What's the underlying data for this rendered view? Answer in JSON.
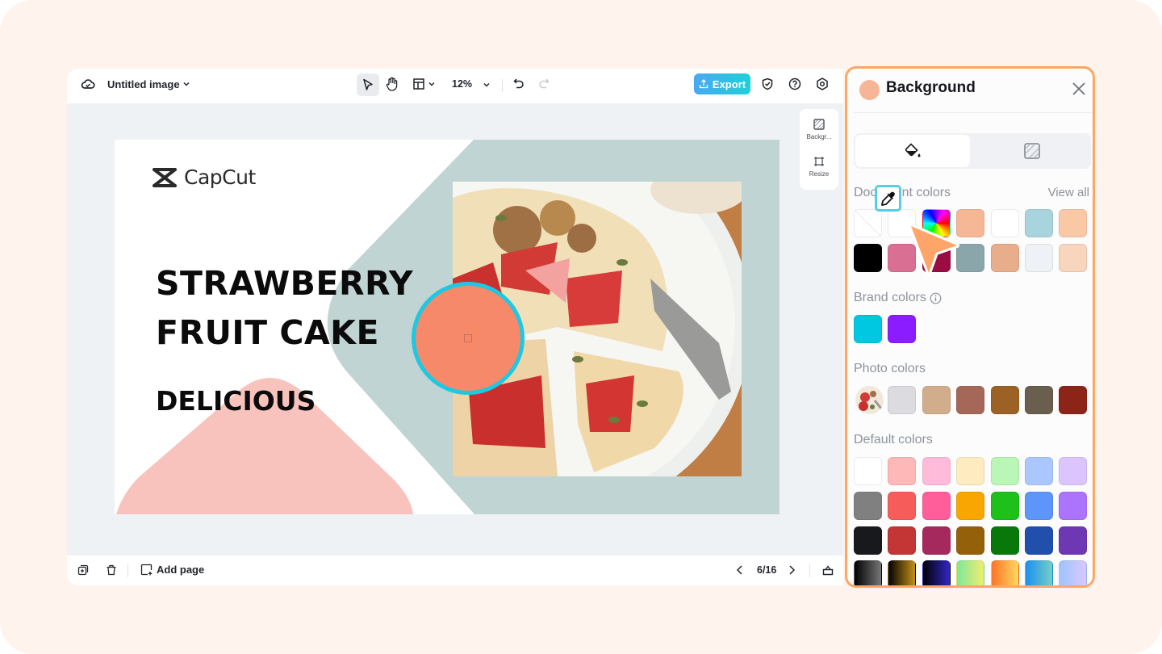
{
  "editor": {
    "doc_title": "Untitled image",
    "zoom_level": "12%",
    "export_label": "Export",
    "side_tools": [
      {
        "label": "Backgr...",
        "icon": "background-icon"
      },
      {
        "label": "Resize",
        "icon": "resize-icon"
      }
    ],
    "add_page_label": "Add page",
    "page_indicator": "6/16"
  },
  "canvas": {
    "logo_text": "CapCut",
    "headline_line1": "STRAWBERRY",
    "headline_line2": "FRUIT CAKE",
    "subheading": "DELICIOUS",
    "colors": {
      "background": "#ffffff",
      "sage_shape": "#c0d5d3",
      "pink_shape": "#f8c3bd",
      "circle_fill": "#f5896a",
      "circle_border": "#1ec8e2"
    }
  },
  "panel": {
    "title": "Background",
    "current_color": "#f6b597",
    "tabs": [
      {
        "name": "fill",
        "icon": "paint-bucket-icon",
        "active": true
      },
      {
        "name": "pattern",
        "icon": "pattern-icon",
        "active": false
      }
    ],
    "document_colors": {
      "label": "Document colors",
      "view_all_label": "View all",
      "swatches": [
        [
          "none",
          "eyedropper",
          "rainbow",
          "#f6b797",
          "#ffffff",
          "#a8d5dd",
          "#f9c9a6"
        ],
        [
          "#000000",
          "#d96f92",
          "#9b0c44",
          "#8aa6ab",
          "#e8ae8c",
          "#eef2f6",
          "#f8d5bd"
        ]
      ]
    },
    "brand_colors": {
      "label": "Brand colors",
      "swatches": [
        "#00c8e0",
        "#8a1cff"
      ]
    },
    "photo_colors": {
      "label": "Photo colors",
      "swatches": [
        "#dcdbe0",
        "#d2ad8b",
        "#a56858",
        "#9c6124",
        "#6a5e4e",
        "#8c2418"
      ]
    },
    "default_colors": {
      "label": "Default colors",
      "rows": [
        [
          "#ffffff",
          "#ffb8b8",
          "#ffbbd9",
          "#ffebc0",
          "#baf6b6",
          "#aac8ff",
          "#dcc5ff"
        ],
        [
          "#808080",
          "#f55c5a",
          "#ff5e9b",
          "#f9a602",
          "#1ec11a",
          "#5d95fb",
          "#ac73fd"
        ],
        [
          "#18191c",
          "#c43535",
          "#a5295c",
          "#94610a",
          "#08780a",
          "#2050ac",
          "#6e38b5"
        ],
        [
          "linear-gradient(90deg,#000,#777)",
          "linear-gradient(90deg,#000,#c8901a)",
          "linear-gradient(90deg,#000,#3326c8)",
          "linear-gradient(90deg,#7de89a,#f2ec6e)",
          "linear-gradient(90deg,#ff7427,#ffd860)",
          "linear-gradient(90deg,#1b8ff0,#75cfc5)",
          "linear-gradient(90deg,#9dc4ff,#dcc7ff)"
        ]
      ]
    }
  }
}
